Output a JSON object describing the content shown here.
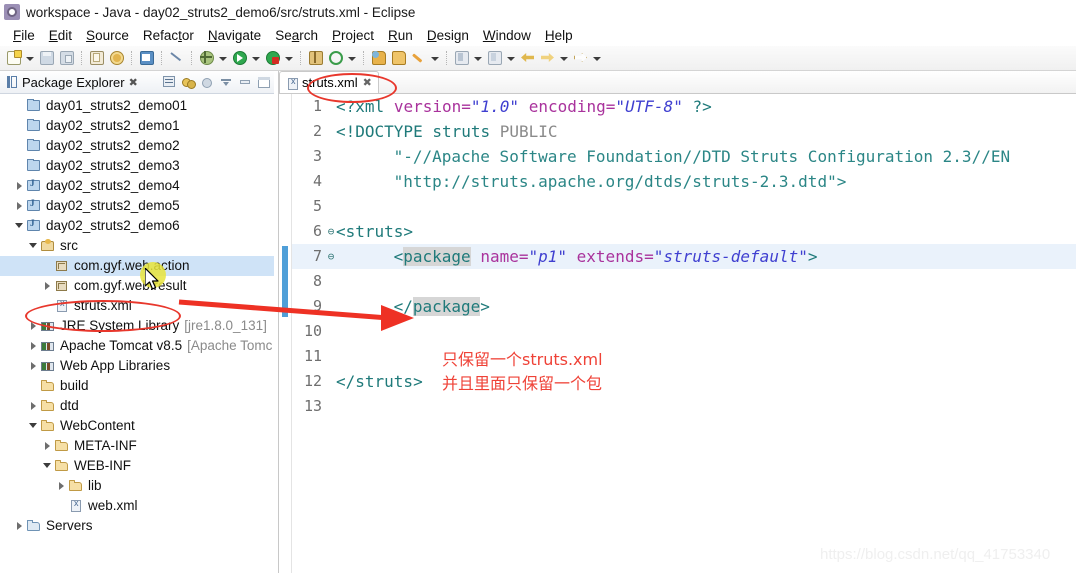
{
  "window": {
    "title": "workspace - Java - day02_struts2_demo6/src/struts.xml - Eclipse",
    "app_icon": "eclipse-icon"
  },
  "menubar": {
    "items": [
      {
        "label": "File",
        "mnemonic": "F"
      },
      {
        "label": "Edit",
        "mnemonic": "E"
      },
      {
        "label": "Source",
        "mnemonic": "S"
      },
      {
        "label": "Refactor",
        "mnemonic": "t"
      },
      {
        "label": "Navigate",
        "mnemonic": "N"
      },
      {
        "label": "Search",
        "mnemonic": "a"
      },
      {
        "label": "Project",
        "mnemonic": "P"
      },
      {
        "label": "Run",
        "mnemonic": "R"
      },
      {
        "label": "Design",
        "mnemonic": "D"
      },
      {
        "label": "Window",
        "mnemonic": "W"
      },
      {
        "label": "Help",
        "mnemonic": "H"
      }
    ]
  },
  "toolbar": {
    "buttons": [
      "new-wizard-icon",
      "new-dropdown-arrow",
      "save-icon",
      "save-all-icon",
      "print-icon",
      "undo-history-icon",
      "new-java-class-icon",
      "link-with-editor-icon",
      "debug-icon",
      "debug-dropdown-arrow",
      "run-icon",
      "run-dropdown-arrow",
      "run-external-tools-icon",
      "external-tools-dropdown-arrow",
      "coverage-icon",
      "refresh-icon",
      "refresh-dropdown-arrow",
      "open-type-icon",
      "open-task-icon",
      "search-icon",
      "search-dropdown-arrow",
      "next-annotation-icon",
      "next-annotation-arrow",
      "previous-annotation-icon",
      "previous-annotation-arrow",
      "back-icon",
      "forward-icon",
      "forward-dropdown-arrow",
      "jump-icon",
      "jump-dropdown-arrow"
    ]
  },
  "explorer": {
    "title": "Package Explorer",
    "close_glyph": "✖",
    "view_toolbar": [
      "collapse-all-icon",
      "link-with-editor-icon",
      "focus-on-active-task-icon",
      "view-menu-icon",
      "minimize-icon",
      "maximize-icon"
    ],
    "tree": [
      {
        "label": "day01_struts2_demo01",
        "icon": "closed-project-icon",
        "indent": 1,
        "twist": "none",
        "selected": false
      },
      {
        "label": "day02_struts2_demo1",
        "icon": "closed-project-icon",
        "indent": 1,
        "twist": "none",
        "selected": false
      },
      {
        "label": "day02_struts2_demo2",
        "icon": "closed-project-icon",
        "indent": 1,
        "twist": "none",
        "selected": false
      },
      {
        "label": "day02_struts2_demo3",
        "icon": "closed-project-icon",
        "indent": 1,
        "twist": "none",
        "selected": false
      },
      {
        "label": "day02_struts2_demo4",
        "icon": "java-project-icon",
        "indent": 1,
        "twist": "closed",
        "selected": false
      },
      {
        "label": "day02_struts2_demo5",
        "icon": "java-project-icon",
        "indent": 1,
        "twist": "closed",
        "selected": false
      },
      {
        "label": "day02_struts2_demo6",
        "icon": "java-project-icon",
        "indent": 1,
        "twist": "open",
        "selected": false
      },
      {
        "label": "src",
        "icon": "source-folder-icon",
        "indent": 2,
        "twist": "open",
        "selected": false
      },
      {
        "label": "com.gyf.web.action",
        "icon": "package-icon",
        "indent": 3,
        "twist": "none",
        "selected": true
      },
      {
        "label": "com.gyf.web.result",
        "icon": "package-icon",
        "indent": 3,
        "twist": "closed",
        "selected": false
      },
      {
        "label": "struts.xml",
        "icon": "xml-file-icon",
        "indent": 3,
        "twist": "none",
        "selected": false
      },
      {
        "label": "JRE System Library",
        "suffix": "[jre1.8.0_131]",
        "icon": "library-icon",
        "indent": 2,
        "twist": "closed",
        "selected": false
      },
      {
        "label": "Apache Tomcat v8.5",
        "suffix": "[Apache Tomc",
        "icon": "library-icon",
        "indent": 2,
        "twist": "closed",
        "selected": false
      },
      {
        "label": "Web App Libraries",
        "icon": "library-icon",
        "indent": 2,
        "twist": "closed",
        "selected": false
      },
      {
        "label": "build",
        "icon": "folder-icon",
        "indent": 2,
        "twist": "none",
        "selected": false
      },
      {
        "label": "dtd",
        "icon": "folder-icon",
        "indent": 2,
        "twist": "closed",
        "selected": false
      },
      {
        "label": "WebContent",
        "icon": "folder-icon",
        "indent": 2,
        "twist": "open",
        "selected": false
      },
      {
        "label": "META-INF",
        "icon": "folder-icon",
        "indent": 3,
        "twist": "closed",
        "selected": false
      },
      {
        "label": "WEB-INF",
        "icon": "folder-icon",
        "indent": 3,
        "twist": "open",
        "selected": false
      },
      {
        "label": "lib",
        "icon": "folder-icon",
        "indent": 4,
        "twist": "closed",
        "selected": false
      },
      {
        "label": "web.xml",
        "icon": "xml-file-icon",
        "indent": 4,
        "twist": "none",
        "selected": false
      },
      {
        "label": "Servers",
        "icon": "servers-folder-icon",
        "indent": 1,
        "twist": "closed",
        "selected": false
      }
    ]
  },
  "editor": {
    "tab": {
      "label": "struts.xml",
      "icon": "xml-file-icon",
      "close_glyph": "✖"
    },
    "lines": [
      {
        "n": "1",
        "fold": "",
        "current": false
      },
      {
        "n": "2",
        "fold": "",
        "current": false
      },
      {
        "n": "3",
        "fold": "",
        "current": false
      },
      {
        "n": "4",
        "fold": "",
        "current": false
      },
      {
        "n": "5",
        "fold": "",
        "current": false
      },
      {
        "n": "6",
        "fold": "⊖",
        "current": false
      },
      {
        "n": "7",
        "fold": "⊖",
        "current": true
      },
      {
        "n": "8",
        "fold": "",
        "current": false
      },
      {
        "n": "9",
        "fold": "",
        "current": false
      },
      {
        "n": "10",
        "fold": "",
        "current": false
      },
      {
        "n": "11",
        "fold": "",
        "current": false
      },
      {
        "n": "12",
        "fold": "",
        "current": false
      },
      {
        "n": "13",
        "fold": "",
        "current": false
      }
    ],
    "code": {
      "l1_open": "<?xml",
      "l1_attr1": "version=",
      "l1_val1": "\"1.0\"",
      "l1_attr2": "encoding=",
      "l1_val2": "\"UTF-8\"",
      "l1_close": "?>",
      "l2_doctype": "<!DOCTYPE struts",
      "l2_public": "PUBLIC",
      "l3": "\"-//Apache Software Foundation//DTD Struts Configuration 2.3//EN",
      "l4": "\"http://struts.apache.org/dtds/struts-2.3.dtd\">",
      "l6": "<struts>",
      "l7_open": "<",
      "l7_tag": "package",
      "l7_attr1": "name=",
      "l7_val1": "\"p1\"",
      "l7_attr2": "extends=",
      "l7_val2": "\"struts-default\"",
      "l7_close": ">",
      "l9_open": "</",
      "l9_tag": "package",
      "l9_close": ">",
      "l12": "</struts>"
    }
  },
  "annotations": {
    "note_line1": "只保留一个struts.xml",
    "note_line2": "并且里面只保留一个包",
    "note_color": "#ef4237",
    "ellipse_color": "#e8372c",
    "arrow_color": "#ee3124",
    "click_halo_color": "#e8e43c"
  },
  "watermark": {
    "text": "https://blog.csdn.net/qq_41753340",
    "color": "#efefef"
  }
}
